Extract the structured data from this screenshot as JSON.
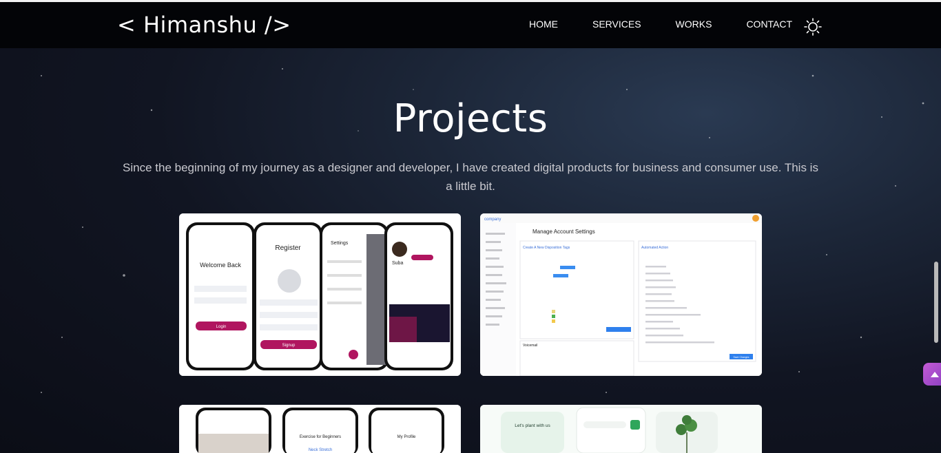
{
  "header": {
    "logo": "< Himanshu />",
    "nav": [
      {
        "label": "HOME"
      },
      {
        "label": "SERVICES"
      },
      {
        "label": "WORKS"
      },
      {
        "label": "CONTACT"
      }
    ],
    "theme_icon": "sun-icon"
  },
  "section": {
    "title": "Projects",
    "subtitle": "Since the beginning of my journey as a designer and developer, I have created digital products for business and consumer use. This is a little bit."
  },
  "projects": [
    {
      "screens": [
        "Welcome Back",
        "Register",
        "Settings",
        "Suba"
      ],
      "buttons": [
        "Login",
        "Signup"
      ]
    },
    {
      "brand": "company",
      "title": "Manage Account Settings",
      "panel_left": "Create A New Disposition Tags",
      "panel_right": "Automated Action",
      "panel_bottom": "Voicemail",
      "save_btn": "Save Changes"
    },
    {
      "screens": [
        "Exercise for Beginners",
        "Neck Stretch",
        "My Profile"
      ]
    },
    {
      "headline": "Let's plant with us"
    }
  ],
  "colors": {
    "accent_gradient_start": "#c45bd6",
    "accent_gradient_end": "#8a3fc0",
    "header_bg": "#030407",
    "pink": "#b0155f",
    "green": "#2fa65b"
  }
}
